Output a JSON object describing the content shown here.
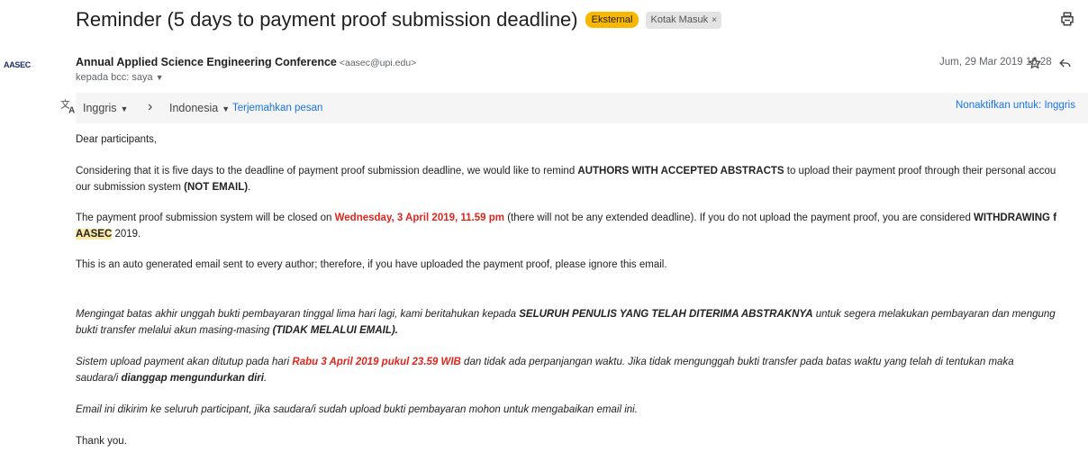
{
  "email": {
    "subject": "Reminder (5 days to payment proof submission deadline)",
    "labels": [
      "Eksternal",
      "Kotak Masuk"
    ],
    "label_close": "×",
    "sender_name": "Annual Applied Science Engineering Conference",
    "sender_email": "<aasec@upi.edu>",
    "recipient": "kepada bcc: saya",
    "date": "Jum, 29 Mar 2019 16.28",
    "avatar_text": "AASEC"
  },
  "translate": {
    "from": "Inggris",
    "to": "Indonesia",
    "translate_link": "Terjemahkan pesan",
    "turnoff_link": "Nonaktifkan untuk: Inggris"
  },
  "body": {
    "greeting": "Dear participants,",
    "p1a": "Considering that it is five days to the deadline of payment proof submission deadline, we would like to remind ",
    "p1b": "AUTHORS WITH ACCEPTED ABSTRACTS",
    "p1c": " to upload their payment proof through their personal accou",
    "p1d": "our submission system ",
    "p1e": "(NOT EMAIL)",
    "p1f": ".",
    "p2a": "The payment proof submission system will be closed on ",
    "p2b": "Wednesday, 3 April 2019, 11.59 pm",
    "p2c": " (there will not be any extended deadline). If you do not upload the payment proof, you are considered ",
    "p2d": "WITHDRAWING f",
    "p2e": "AASEC",
    "p2f": " 2019.",
    "p3": "This is an auto generated email sent to every author; therefore, if you have uploaded the payment proof, please ignore this email.",
    "p4a": "Mengingat batas akhir unggah bukti pembayaran tinggal lima hari lagi, kami beritahukan kepada ",
    "p4b": "SELURUH PENULIS YANG TELAH DITERIMA ABSTRAKNYA",
    "p4c": " untuk segera melakukan pembayaran dan mengung",
    "p4d": "bukti transfer melalui akun masing-masing ",
    "p4e": "(TIDAK MELALUI EMAIL).",
    "p5a": "Sistem upload payment akan ditutup pada hari ",
    "p5b": "Rabu 3 April 2019 pukul 23.59 WIB",
    "p5c": " dan tidak ada perpanjangan waktu. Jika tidak mengunggah bukti transfer pada batas waktu yang telah di tentukan maka",
    "p5d": "saudara/i ",
    "p5e": "dianggap mengundurkan diri",
    "p5f": ".",
    "p6": "Email ini dikirim ke seluruh participant, jika saudara/i sudah upload bukti pembayaran mohon untuk mengabaikan email ini.",
    "closing": "Thank you."
  }
}
